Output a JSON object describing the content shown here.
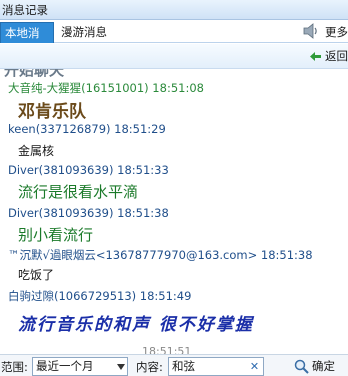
{
  "window": {
    "title": "消息记录"
  },
  "tabs": [
    {
      "label": "本地消息",
      "active": true
    },
    {
      "label": "漫游消息",
      "active": false
    }
  ],
  "toolbar": {
    "more_label": "更多",
    "back_label": "返回"
  },
  "messages": {
    "clipped_top_text": "开始聊天",
    "items": [
      {
        "sender": "大音纯-大猩猩(16151001) 18:51:08",
        "text": "邓肯乐队"
      },
      {
        "sender": "keen(337126879) 18:51:29",
        "text": "金属核"
      },
      {
        "sender": "Diver(381093639) 18:51:33",
        "text": "流行是很看水平滴"
      },
      {
        "sender": "Diver(381093639) 18:51:38",
        "text": "别小看流行"
      },
      {
        "sender": "™沉默√過眼烟云<13678777970@163.com> 18:51:38",
        "text": "吃饭了"
      },
      {
        "sender": "白驹过隙(1066729513) 18:51:49",
        "text": "流行音乐的和声 很不好掌握"
      }
    ],
    "clipped_bottom_text": "18:51:51"
  },
  "filter": {
    "range_label": "范围:",
    "range_value": "最近一个月",
    "content_label": "内容:",
    "content_value": "和弦",
    "confirm_label": "确定"
  },
  "colors": {
    "tab_active_bg": "#2f8cd8",
    "sender_green": "#2b8a3b",
    "sender_blue": "#1f4e8a"
  }
}
